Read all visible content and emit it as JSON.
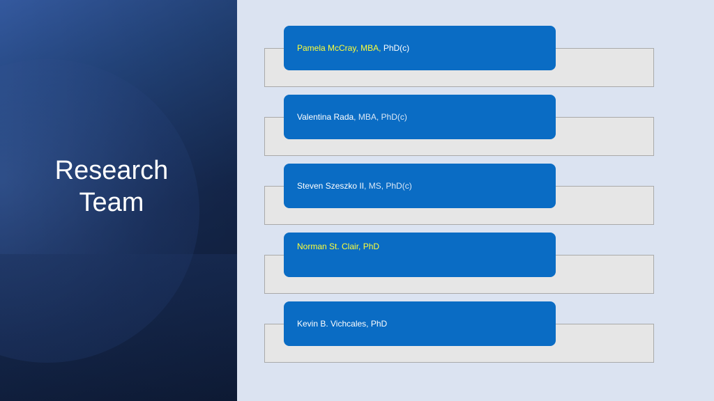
{
  "slide": {
    "title_line1": "Research",
    "title_line2": "Team"
  },
  "members": [
    {
      "name": "Pamela McCray, MBA, ",
      "credentials": "PhD(c)"
    },
    {
      "name": "Valentina Rada",
      "credentials": ", MBA, PhD(c)"
    },
    {
      "name": "Steven Szeszko II",
      "credentials": ", MS, PhD(c)"
    },
    {
      "name": "Norman St. Clair, PhD",
      "credentials": ""
    },
    {
      "name": "Kevin B. Vichcales, PhD",
      "credentials": ""
    }
  ],
  "colors": {
    "card": "#0a6cc4",
    "highlight_text": "#ffff38",
    "base_strip": "#e6e6e6",
    "background": "#dbe3f1"
  }
}
